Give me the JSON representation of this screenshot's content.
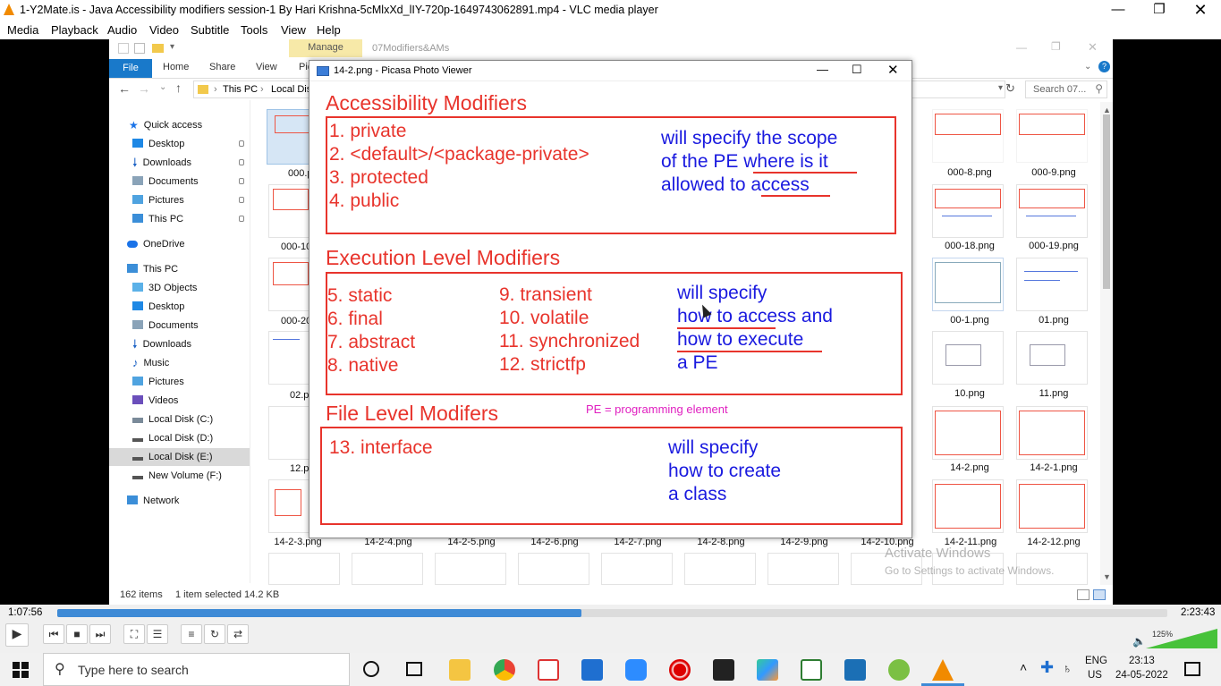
{
  "vlc": {
    "window_title": "1-Y2Mate.is - Java Accessibility modifiers session-1  By Hari Krishna-5cMlxXd_lIY-720p-1649743062891.mp4 - VLC media player",
    "menu": [
      "Media",
      "Playback",
      "Audio",
      "Video",
      "Subtitle",
      "Tools",
      "View",
      "Help"
    ],
    "time_elapsed": "1:07:56",
    "time_total": "2:23:43",
    "progress": 0.472,
    "volume_label": "125%",
    "volume": 1.0
  },
  "explorer": {
    "manage_tab": "Manage",
    "folder_title": "07Modifiers&AMs",
    "ribbon_tabs": [
      "File",
      "Home",
      "Share",
      "View",
      "Pic"
    ],
    "address": [
      "This PC",
      "Local Dis"
    ],
    "search_placeholder": "Search 07...",
    "nav": {
      "quick_access": "Quick access",
      "quick_items": [
        "Desktop",
        "Downloads",
        "Documents",
        "Pictures",
        "This PC"
      ],
      "onedrive": "OneDrive",
      "this_pc": "This PC",
      "pc_items": [
        "3D Objects",
        "Desktop",
        "Documents",
        "Downloads",
        "Music",
        "Pictures",
        "Videos",
        "Local Disk (C:)",
        "Local Disk (D:)",
        "Local Disk (E:)",
        "New Volume (F:)"
      ],
      "network": "Network"
    },
    "left_labels": [
      "000.p",
      "000-10",
      "000-20",
      "02.p",
      "12.p"
    ],
    "right_labels": [
      [
        "000-8.png",
        "000-9.png"
      ],
      [
        "000-18.png",
        "000-19.png"
      ],
      [
        "00-1.png",
        "01.png"
      ],
      [
        "10.png",
        "11.png"
      ],
      [
        "14-2.png",
        "14-2-1.png"
      ]
    ],
    "bottom_labels": [
      "14-2-3.png",
      "14-2-4.png",
      "14-2-5.png",
      "14-2-6.png",
      "14-2-7.png",
      "14-2-8.png",
      "14-2-9.png",
      "14-2-10.png",
      "14-2-11.png",
      "14-2-12.png"
    ],
    "status": {
      "items": "162 items",
      "selected": "1 item selected  14.2 KB"
    },
    "watermark1": "Activate Windows",
    "watermark2": "Go to Settings to activate Windows."
  },
  "picasa": {
    "title": "14-2.png - Picasa Photo Viewer",
    "slide": {
      "h1": "Accessibility Modifiers",
      "access": [
        "1. private",
        "2. <default>/<package-private>",
        "3. protected",
        "4. public"
      ],
      "access_note": [
        "will specify the scope",
        "of the PE where is it",
        "allowed to access"
      ],
      "h2": "Execution Level Modifiers",
      "exec_col1": [
        "5. static",
        "6. final",
        "7. abstract",
        "8. native"
      ],
      "exec_col2": [
        "9. transient",
        "10. volatile",
        "11. synchronized",
        "12. strictfp"
      ],
      "exec_note": [
        "will specify",
        "how to access and",
        "how to execute",
        "a PE"
      ],
      "pe_note": "PE = programming element",
      "h3": "File Level Modifers",
      "file": "13. interface",
      "file_note": [
        "will specify",
        "how to create",
        "a class"
      ]
    }
  },
  "taskbar": {
    "search_placeholder": "Type here to search",
    "lang1": "ENG",
    "lang2": "US",
    "time": "23:13",
    "date": "24-05-2022"
  }
}
